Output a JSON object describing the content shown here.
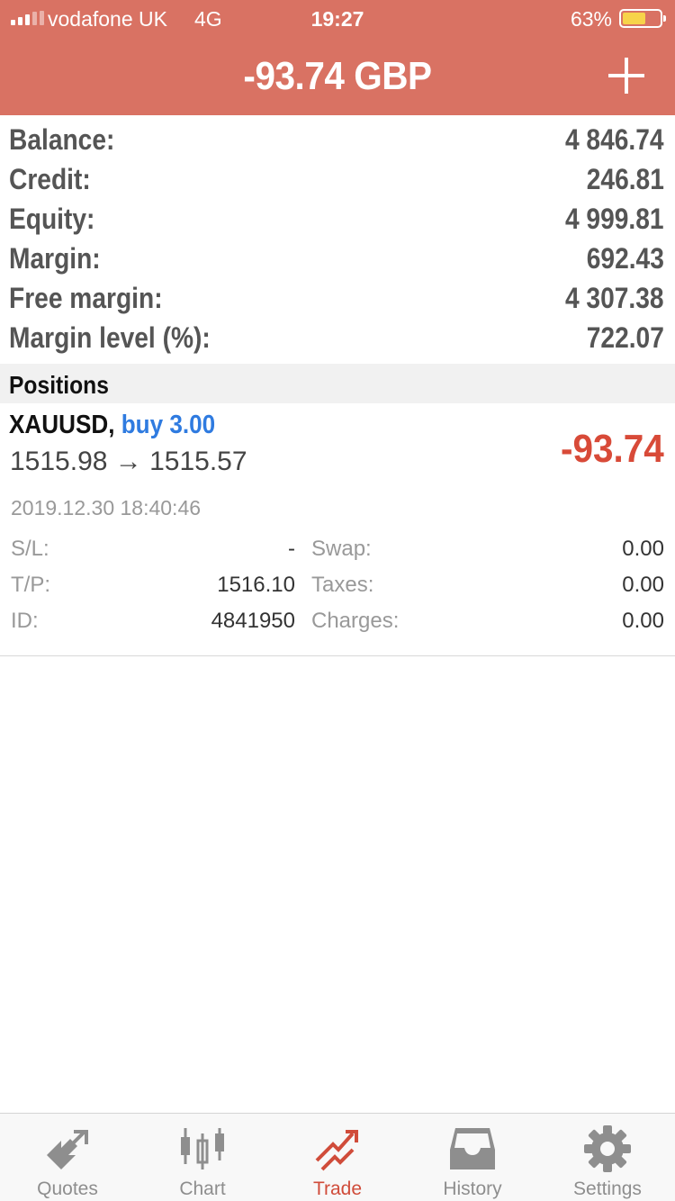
{
  "status_bar": {
    "carrier": "vodafone UK",
    "network": "4G",
    "time": "19:27",
    "battery_percent": "63%",
    "battery_level": 0.63
  },
  "header": {
    "title": "-93.74 GBP",
    "add_icon": "plus-icon",
    "color": "#d97263"
  },
  "summary": [
    {
      "label": "Balance:",
      "value": "4 846.74"
    },
    {
      "label": "Credit:",
      "value": "246.81"
    },
    {
      "label": "Equity:",
      "value": "4 999.81"
    },
    {
      "label": "Margin:",
      "value": "692.43"
    },
    {
      "label": "Free margin:",
      "value": "4 307.38"
    },
    {
      "label": "Margin level (%):",
      "value": "722.07"
    }
  ],
  "positions": {
    "section_title": "Positions",
    "items": [
      {
        "symbol": "XAUUSD,",
        "direction": "buy 3.00",
        "prices": "1515.98 → 1515.57",
        "profit": "-93.74",
        "open_time": "2019.12.30 18:40:46",
        "details": [
          {
            "label": "S/L:",
            "value": "-",
            "label2": "Swap:",
            "value2": "0.00"
          },
          {
            "label": "T/P:",
            "value": "1516.10",
            "label2": "Taxes:",
            "value2": "0.00"
          },
          {
            "label": "ID:",
            "value": "4841950",
            "label2": "Charges:",
            "value2": "0.00"
          }
        ]
      }
    ]
  },
  "tabs": [
    {
      "label": "Quotes",
      "icon": "quotes-arrows-icon",
      "active": false
    },
    {
      "label": "Chart",
      "icon": "candlestick-icon",
      "active": false
    },
    {
      "label": "Trade",
      "icon": "trade-trend-icon",
      "active": true
    },
    {
      "label": "History",
      "icon": "inbox-tray-icon",
      "active": false
    },
    {
      "label": "Settings",
      "icon": "gear-icon",
      "active": false
    }
  ],
  "colors": {
    "accent": "#d04c3a",
    "buy": "#2f7be0",
    "loss": "#d84a38",
    "tab_inactive": "#8e8e8e"
  }
}
